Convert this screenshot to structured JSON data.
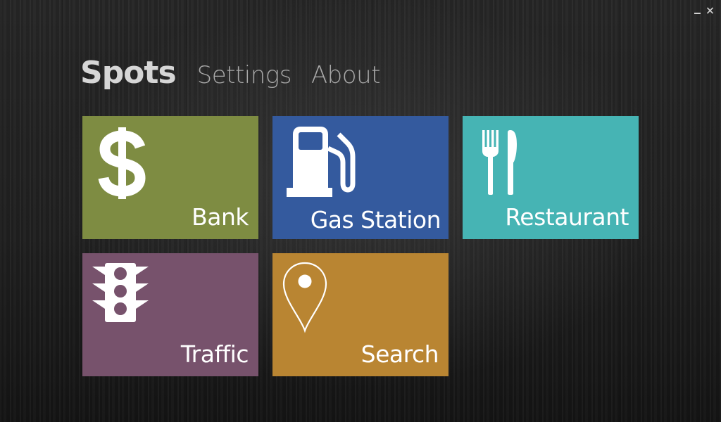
{
  "window": {
    "minimize_icon": "minimize-icon",
    "close_icon": "close-icon"
  },
  "nav": {
    "items": [
      {
        "label": "Spots",
        "active": true
      },
      {
        "label": "Settings",
        "active": false
      },
      {
        "label": "About",
        "active": false
      }
    ]
  },
  "tiles": [
    {
      "label": "Bank",
      "icon": "dollar-icon",
      "color": "#7e8c42"
    },
    {
      "label": "Gas Station",
      "icon": "fuel-pump-icon",
      "color": "#345a9e"
    },
    {
      "label": "Restaurant",
      "icon": "fork-knife-icon",
      "color": "#46b4b4"
    },
    {
      "label": "Traffic",
      "icon": "traffic-light-icon",
      "color": "#77526c"
    },
    {
      "label": "Search",
      "icon": "map-pin-icon",
      "color": "#b98532"
    }
  ],
  "colors": {
    "background": "#1e1e1e",
    "nav_active": "#d6d6d6",
    "nav_inactive": "#a8a8a8",
    "tile_text": "#ffffff"
  }
}
